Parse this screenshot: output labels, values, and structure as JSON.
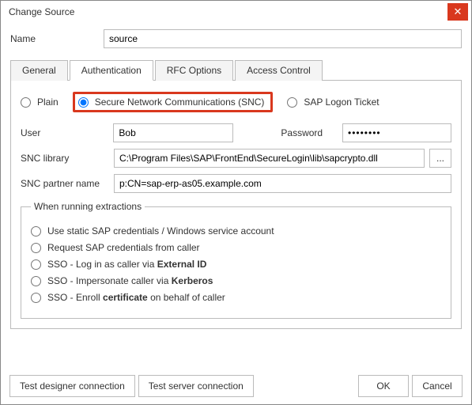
{
  "window": {
    "title": "Change Source"
  },
  "name": {
    "label": "Name",
    "value": "source"
  },
  "tabs": {
    "general": "General",
    "authentication": "Authentication",
    "rfc": "RFC Options",
    "access": "Access Control"
  },
  "auth": {
    "mode": {
      "plain": "Plain",
      "snc": "Secure Network Communications (SNC)",
      "ticket": "SAP Logon Ticket"
    },
    "user_label": "User",
    "user_value": "Bob",
    "password_label": "Password",
    "password_value": "••••••••",
    "snc_library_label": "SNC library",
    "snc_library_value": "C:\\Program Files\\SAP\\FrontEnd\\SecureLogin\\lib\\sapcrypto.dll",
    "snc_partner_label": "SNC partner name",
    "snc_partner_value": "p:CN=sap-erp-as05.example.com",
    "browse": "..."
  },
  "extractions": {
    "legend": "When running extractions",
    "opt1_a": "Use static SAP credentials / Windows service account",
    "opt2_a": "Request SAP credentials from caller",
    "opt3_a": "SSO - Log in as caller via ",
    "opt3_b": "External ID",
    "opt4_a": "SSO - Impersonate caller via ",
    "opt4_b": "Kerberos",
    "opt5_a": "SSO - Enroll ",
    "opt5_b": "certificate",
    "opt5_c": " on behalf of caller"
  },
  "footer": {
    "test_designer": "Test designer connection",
    "test_server": "Test server connection",
    "ok": "OK",
    "cancel": "Cancel"
  }
}
